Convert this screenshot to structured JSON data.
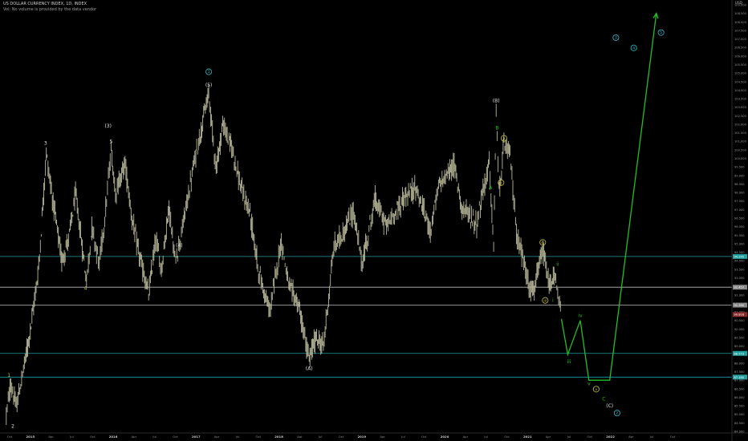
{
  "header": {
    "title": "US DOLLAR CURRENCY INDEX, 1D, INDEX",
    "subtitle": "Vol: No volume is provided by the data vendor"
  },
  "axis": {
    "currency_label": "USD"
  },
  "colors": {
    "background": "#000000",
    "candles": "#b8b89a",
    "hline": "#20a0a0",
    "hline_white": "#bbbbbb",
    "green": "#22c022",
    "yellow": "#c8c040",
    "cyan": "#30c0d0",
    "white_label": "#e0e0e0"
  },
  "chart_data": {
    "type": "line",
    "title": "US DOLLAR CURRENCY INDEX, 1D, INDEX",
    "xlabel": "",
    "ylabel": "",
    "x_ticks": [
      "Oct",
      "2015",
      "Apr",
      "Jul",
      "Oct",
      "2016",
      "Apr",
      "Jul",
      "Oct",
      "2017",
      "Apr",
      "Jul",
      "Oct",
      "2018",
      "Apr",
      "Jul",
      "Oct",
      "2019",
      "Apr",
      "Jul",
      "Oct",
      "2020",
      "Apr",
      "Jul",
      "Oct",
      "2021",
      "Apr",
      "Jul",
      "Oct",
      "2022",
      "Apr",
      "Jul",
      "Oct"
    ],
    "y_ticks": [
      "109.000",
      "108.500",
      "108.000",
      "107.500",
      "107.000",
      "106.500",
      "106.000",
      "105.500",
      "105.000",
      "104.500",
      "104.000",
      "103.500",
      "103.000",
      "102.500",
      "102.000",
      "101.500",
      "101.000",
      "100.500",
      "100.000",
      "99.500",
      "99.000",
      "98.500",
      "98.000",
      "97.500",
      "97.000",
      "96.500",
      "96.000",
      "95.500",
      "95.000",
      "94.500",
      "94.000",
      "93.500",
      "93.000",
      "92.500",
      "92.000",
      "91.500",
      "91.000",
      "90.500",
      "90.000",
      "89.500",
      "89.000",
      "88.500",
      "88.000",
      "87.500",
      "87.000",
      "86.500",
      "86.000",
      "85.500",
      "85.000",
      "84.500",
      "84.000"
    ],
    "ylim": [
      84.0,
      109.0
    ],
    "price_path": [
      {
        "t": "2014-10-01",
        "v": 85.0
      },
      {
        "t": "2014-10-20",
        "v": 86.8
      },
      {
        "t": "2014-11-10",
        "v": 85.4
      },
      {
        "t": "2014-12-10",
        "v": 87.6
      },
      {
        "t": "2015-01-10",
        "v": 90.2
      },
      {
        "t": "2015-02-10",
        "v": 93.6
      },
      {
        "t": "2015-03-13",
        "v": 100.3
      },
      {
        "t": "2015-04-10",
        "v": 97.4
      },
      {
        "t": "2015-05-15",
        "v": 94.0
      },
      {
        "t": "2015-06-15",
        "v": 95.5
      },
      {
        "t": "2015-07-10",
        "v": 97.9
      },
      {
        "t": "2015-08-24",
        "v": 92.8
      },
      {
        "t": "2015-09-15",
        "v": 96.0
      },
      {
        "t": "2015-10-15",
        "v": 93.8
      },
      {
        "t": "2015-11-10",
        "v": 97.0
      },
      {
        "t": "2015-12-02",
        "v": 100.5
      },
      {
        "t": "2015-12-20",
        "v": 98.0
      },
      {
        "t": "2016-01-28",
        "v": 99.7
      },
      {
        "t": "2016-02-25",
        "v": 96.5
      },
      {
        "t": "2016-03-15",
        "v": 95.0
      },
      {
        "t": "2016-05-03",
        "v": 92.0
      },
      {
        "t": "2016-06-01",
        "v": 95.3
      },
      {
        "t": "2016-06-24",
        "v": 93.5
      },
      {
        "t": "2016-07-25",
        "v": 97.2
      },
      {
        "t": "2016-08-18",
        "v": 94.0
      },
      {
        "t": "2016-09-10",
        "v": 95.3
      },
      {
        "t": "2016-10-20",
        "v": 98.5
      },
      {
        "t": "2016-11-15",
        "v": 100.5
      },
      {
        "t": "2017-01-03",
        "v": 103.8
      },
      {
        "t": "2017-02-02",
        "v": 99.4
      },
      {
        "t": "2017-03-01",
        "v": 102.0
      },
      {
        "t": "2017-04-10",
        "v": 100.5
      },
      {
        "t": "2017-05-15",
        "v": 98.2
      },
      {
        "t": "2017-06-20",
        "v": 96.8
      },
      {
        "t": "2017-07-25",
        "v": 93.4
      },
      {
        "t": "2017-09-08",
        "v": 91.0
      },
      {
        "t": "2017-10-26",
        "v": 95.2
      },
      {
        "t": "2017-11-25",
        "v": 92.5
      },
      {
        "t": "2018-01-02",
        "v": 91.5
      },
      {
        "t": "2018-02-16",
        "v": 88.2
      },
      {
        "t": "2018-03-15",
        "v": 89.5
      },
      {
        "t": "2018-04-15",
        "v": 89.0
      },
      {
        "t": "2018-05-28",
        "v": 94.8
      },
      {
        "t": "2018-06-30",
        "v": 95.5
      },
      {
        "t": "2018-08-15",
        "v": 96.9
      },
      {
        "t": "2018-09-20",
        "v": 93.8
      },
      {
        "t": "2018-11-12",
        "v": 97.6
      },
      {
        "t": "2018-12-28",
        "v": 96.0
      },
      {
        "t": "2019-03-07",
        "v": 97.6
      },
      {
        "t": "2019-04-26",
        "v": 98.3
      },
      {
        "t": "2019-06-25",
        "v": 95.8
      },
      {
        "t": "2019-08-01",
        "v": 98.5
      },
      {
        "t": "2019-09-30",
        "v": 99.6
      },
      {
        "t": "2019-11-01",
        "v": 97.1
      },
      {
        "t": "2019-12-31",
        "v": 96.2
      },
      {
        "t": "2020-02-20",
        "v": 99.8
      },
      {
        "t": "2020-03-09",
        "v": 94.6
      },
      {
        "t": "2020-03-19",
        "v": 102.9
      },
      {
        "t": "2020-03-31",
        "v": 98.0
      },
      {
        "t": "2020-04-20",
        "v": 100.8
      },
      {
        "t": "2020-05-15",
        "v": 100.2
      },
      {
        "t": "2020-06-10",
        "v": 95.7
      },
      {
        "t": "2020-07-31",
        "v": 92.6
      },
      {
        "t": "2020-08-18",
        "v": 92.1
      },
      {
        "t": "2020-09-25",
        "v": 94.6
      },
      {
        "t": "2020-10-21",
        "v": 92.5
      },
      {
        "t": "2020-11-10",
        "v": 93.2
      },
      {
        "t": "2020-11-25",
        "v": 92.0
      },
      {
        "t": "2020-12-10",
        "v": 90.7
      }
    ],
    "projection": [
      {
        "t": "2020-12-10",
        "v": 90.6
      },
      {
        "t": "2021-01-05",
        "v": 88.5
      },
      {
        "t": "2021-02-25",
        "v": 90.5
      },
      {
        "t": "2021-04-01",
        "v": 87.0
      },
      {
        "t": "2021-06-25",
        "v": 87.0
      },
      {
        "t": "2022-01-01",
        "v": 108.5
      }
    ],
    "horizontal_lines": [
      {
        "value": 94.25,
        "label": "94.245",
        "kind": "teal"
      },
      {
        "value": 92.45,
        "label": "92.457",
        "kind": "white"
      },
      {
        "value": 91.4,
        "label": "91.390",
        "kind": "white"
      },
      {
        "value": 88.57,
        "label": "88.573",
        "kind": "teal"
      },
      {
        "value": 87.18,
        "label": "87.180",
        "kind": "teal"
      }
    ],
    "price_tags": [
      {
        "value": 90.85,
        "label": "90.816",
        "color": "#8a2a2a"
      }
    ],
    "annotations": [
      {
        "t": "2014-10-12",
        "v": 87.2,
        "text": "1",
        "color": "yellow"
      },
      {
        "t": "2014-10-28",
        "v": 84.2,
        "text": "2",
        "color": "white"
      },
      {
        "t": "2015-03-10",
        "v": 100.8,
        "text": "3",
        "color": "white"
      },
      {
        "t": "2015-08-20",
        "v": 92.3,
        "text": "4",
        "color": "yellow"
      },
      {
        "t": "2015-12-02",
        "v": 100.9,
        "text": "5",
        "color": "white"
      },
      {
        "t": "2015-11-20",
        "v": 101.8,
        "text": "(3)",
        "color": "white"
      },
      {
        "t": "2016-09-05",
        "v": 94.8,
        "text": "(4)",
        "color": "white"
      },
      {
        "t": "2017-01-03",
        "v": 104.2,
        "text": "(5)",
        "color": "white"
      },
      {
        "t": "2017-01-03",
        "v": 105.0,
        "text": "1",
        "color": "cyan",
        "circled": true
      },
      {
        "t": "2018-02-16",
        "v": 87.6,
        "text": "(A)",
        "color": "white"
      },
      {
        "t": "2020-03-19",
        "v": 103.3,
        "text": "(B)",
        "color": "white"
      },
      {
        "t": "2020-02-25",
        "v": 98.2,
        "text": "A",
        "color": "green"
      },
      {
        "t": "2020-03-23",
        "v": 101.7,
        "text": "B",
        "color": "green"
      },
      {
        "t": "2020-04-20",
        "v": 101.1,
        "text": "b",
        "color": "yellow",
        "circled": true
      },
      {
        "t": "2020-04-08",
        "v": 98.5,
        "text": "c",
        "color": "yellow",
        "circled": true
      },
      {
        "t": "2020-09-25",
        "v": 95.0,
        "text": "iv",
        "color": "yellow",
        "circled": true
      },
      {
        "t": "2020-10-05",
        "v": 91.6,
        "text": "iii",
        "color": "yellow",
        "circled": true
      },
      {
        "t": "2020-11-25",
        "v": 93.7,
        "text": "ii",
        "color": "green"
      },
      {
        "t": "2020-11-05",
        "v": 91.6,
        "text": "i",
        "color": "green"
      },
      {
        "t": "2021-01-10",
        "v": 88.0,
        "text": "iii",
        "color": "green"
      },
      {
        "t": "2021-02-25",
        "v": 90.7,
        "text": "iv",
        "color": "green"
      },
      {
        "t": "2021-04-01",
        "v": 86.7,
        "text": "v",
        "color": "green"
      },
      {
        "t": "2021-05-01",
        "v": 86.4,
        "text": "v",
        "color": "yellow",
        "circled": true
      },
      {
        "t": "2021-06-01",
        "v": 85.8,
        "text": "C",
        "color": "green"
      },
      {
        "t": "2021-06-25",
        "v": 85.4,
        "text": "(C)",
        "color": "white"
      },
      {
        "t": "2021-07-25",
        "v": 85.0,
        "text": "2",
        "color": "cyan",
        "circled": true
      },
      {
        "t": "2021-07-20",
        "v": 107.0,
        "text": "3",
        "color": "cyan",
        "circled": true
      },
      {
        "t": "2021-10-01",
        "v": 106.4,
        "text": "4",
        "color": "cyan",
        "circled": true
      },
      {
        "t": "2022-01-20",
        "v": 107.3,
        "text": "5",
        "color": "cyan",
        "circled": true
      }
    ],
    "grid": false,
    "legend": "none"
  }
}
